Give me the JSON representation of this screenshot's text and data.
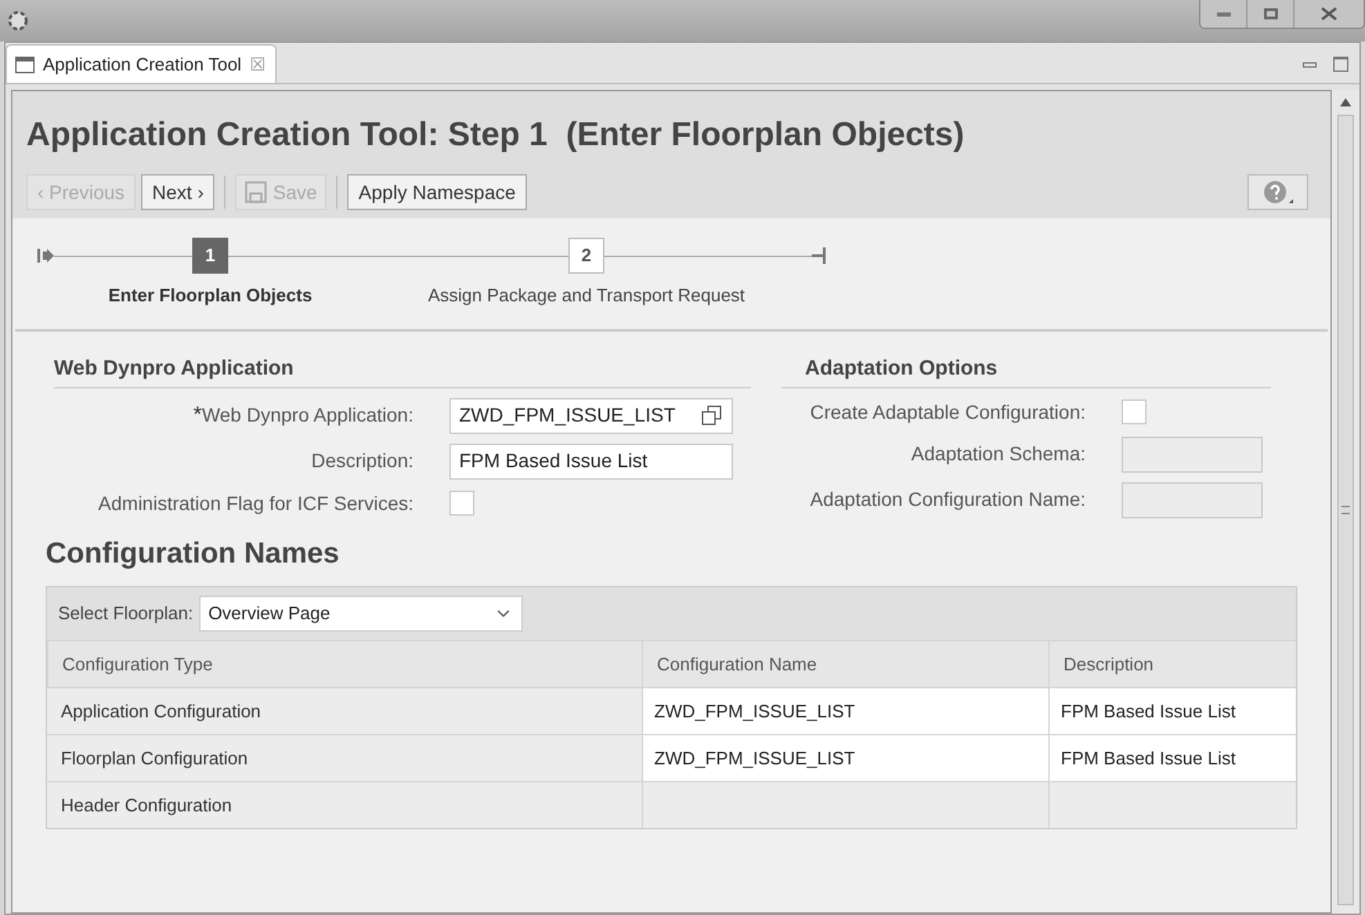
{
  "editor_tab": {
    "label": "Application Creation Tool",
    "close": "☒"
  },
  "page_title": "Application Creation Tool: Step 1  (Enter Floorplan Objects)",
  "toolbar": [
    {
      "label": "‹ Previous",
      "kind": "button",
      "disabled": true
    },
    {
      "label": "Next ›",
      "kind": "button",
      "disabled": false
    },
    {
      "kind": "separator"
    },
    {
      "label": "Save",
      "kind": "save",
      "disabled": true
    },
    {
      "kind": "separator"
    },
    {
      "label": "Apply Namespace",
      "kind": "button",
      "disabled": false
    }
  ],
  "steps": [
    {
      "number": "1",
      "label": "Enter Floorplan Objects",
      "selected": true
    },
    {
      "number": "2",
      "label": "Assign Package and Transport Request",
      "selected": false
    }
  ],
  "web_dynpro": {
    "title": "Web Dynpro Application",
    "fields": [
      {
        "label": "Web Dynpro Application:",
        "required_mark": "*",
        "kind": "value_help",
        "value": "ZWD_FPM_ISSUE_LIST"
      },
      {
        "label": "Description:",
        "kind": "text",
        "value": "FPM Based Issue List"
      },
      {
        "label": "Administration Flag for ICF Services:",
        "kind": "checkbox",
        "checked": false
      }
    ]
  },
  "adaptation": {
    "title": "Adaptation Options",
    "fields": [
      {
        "label": "Create Adaptable Configuration:",
        "kind": "checkbox",
        "checked": false
      },
      {
        "label": "Adaptation Schema:",
        "kind": "text",
        "disabled": true
      },
      {
        "label": "Adaptation Configuration Name:",
        "kind": "text",
        "disabled": true
      }
    ]
  },
  "configuration": {
    "title": "Configuration Names",
    "floorplan_label": "Select Floorplan:",
    "floorplan": "Overview Page",
    "columns": [
      "Configuration Type",
      "Configuration Name",
      "Description"
    ],
    "rows": [
      {
        "type": "Application Configuration",
        "name": "ZWD_FPM_ISSUE_LIST",
        "description": "FPM Based Issue List",
        "editable": true
      },
      {
        "type": "Floorplan Configuration",
        "name": "ZWD_FPM_ISSUE_LIST",
        "description": "FPM Based Issue List",
        "editable": true
      },
      {
        "type": "Header Configuration",
        "editable": false
      }
    ]
  }
}
